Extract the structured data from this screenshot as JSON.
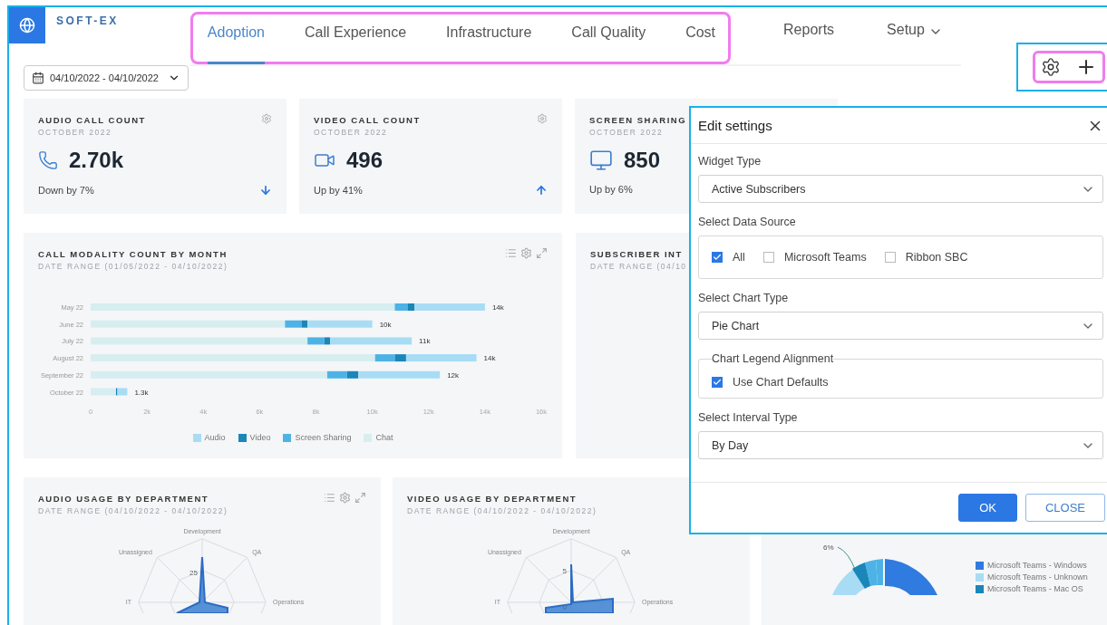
{
  "app": {
    "logo_text": "SOFT-EX"
  },
  "nav": {
    "tabs": [
      {
        "label": "Adoption",
        "selected": true,
        "kind": "tab"
      },
      {
        "label": "Call Experience",
        "selected": false,
        "kind": "tab"
      },
      {
        "label": "Infrastructure",
        "selected": false,
        "kind": "tab"
      },
      {
        "label": "Call Quality",
        "selected": false,
        "kind": "tab"
      },
      {
        "label": "Cost",
        "selected": false,
        "kind": "tab"
      },
      {
        "label": "Reports",
        "selected": false,
        "kind": "tab"
      },
      {
        "label": "Setup",
        "selected": false,
        "kind": "menu"
      }
    ]
  },
  "date_range": {
    "value": "04/10/2022 - 04/10/2022"
  },
  "kpi_cards": [
    {
      "kind": "audio",
      "title": "AUDIO CALL COUNT",
      "subtitle": "OCTOBER 2022",
      "value": "2.70k",
      "change": "Down by 7%",
      "rising": false,
      "settings": true
    },
    {
      "kind": "video",
      "title": "VIDEO CALL COUNT",
      "subtitle": "OCTOBER 2022",
      "value": "496",
      "change": "Up by 41%",
      "rising": true,
      "settings": true
    },
    {
      "kind": "screen",
      "title": "SCREEN SHARING",
      "subtitle": "OCTOBER 2022",
      "value": "850",
      "change": "Up by 6%",
      "settings": false
    }
  ],
  "modality_card": {
    "title": "CALL MODALITY COUNT BY MONTH",
    "subtitle": "DATE RANGE (01/05/2022 - 04/10/2022)",
    "chart_data": {
      "type": "bar",
      "orientation": "horizontal",
      "stacked": true,
      "categories": [
        "May 22",
        "June 22",
        "July 22",
        "August 22",
        "September 22",
        "October 22"
      ],
      "series": [
        {
          "name": "Audio",
          "color": "#a8dcf5",
          "values": [
            2.5,
            2.3,
            2.9,
            2.5,
            2.9,
            0.35
          ]
        },
        {
          "name": "Video",
          "color": "#1b86b8",
          "values": [
            0.25,
            0.2,
            0.2,
            0.4,
            0.4,
            0.05
          ]
        },
        {
          "name": "Screen Sharing",
          "color": "#4db3e6",
          "values": [
            0.45,
            0.6,
            0.6,
            0.7,
            0.7,
            0
          ]
        },
        {
          "name": "Chat",
          "color": "#d6eef0",
          "values": [
            10.8,
            6.9,
            7.7,
            10.1,
            8.4,
            0.9
          ]
        }
      ],
      "xlim": [
        0,
        16
      ],
      "xticks": [
        0,
        {
          "value": 2,
          "label": "2k"
        },
        {
          "value": 4,
          "label": "4k"
        },
        {
          "value": 6,
          "label": "6k"
        },
        {
          "value": 8,
          "label": "8k"
        },
        {
          "value": 10,
          "label": "10k"
        },
        {
          "value": 12,
          "label": "12k"
        },
        {
          "value": 14,
          "label": "14k"
        },
        {
          "value": 16,
          "label": "16k"
        }
      ],
      "value_labels": [
        "14k",
        "10k",
        "11k",
        "14k",
        "12k",
        "1.3k"
      ]
    }
  },
  "subscriber_card": {
    "title": "SUBSCRIBER INT",
    "subtitle": "DATE RANGE (04/10"
  },
  "department_cards": [
    {
      "title": "AUDIO USAGE BY DEPARTMENT",
      "subtitle": "DATE RANGE (04/10/2022 - 04/10/2022)",
      "toolbar": true,
      "axes": [
        "Development",
        "QA",
        "Operations",
        "IT",
        "Unassigned"
      ],
      "scale_labels": [
        "25"
      ]
    },
    {
      "title": "VIDEO USAGE BY DEPARTMENT",
      "subtitle": "DATE RANGE (04/10/2022 - 04/10/2022)",
      "toolbar": false,
      "axes": [
        "Development",
        "QA",
        "Operations",
        "IT",
        "Unassigned"
      ],
      "scale_labels": [
        "5",
        "0"
      ]
    }
  ],
  "platform_card": {
    "slice_label": "6%",
    "legend": [
      {
        "label": "Microsoft Teams - Windows",
        "color": "#2f7be0"
      },
      {
        "label": "Microsoft Teams - Unknown",
        "color": "#a8dcf5"
      },
      {
        "label": "Microsoft Teams - Mac OS",
        "color": "#1b86b8"
      }
    ]
  },
  "modal": {
    "title": "Edit settings",
    "widget_type": {
      "label": "Widget Type",
      "value": "Active Subscribers"
    },
    "data_source_label": "Select Data Source",
    "data_sources": [
      {
        "label": "All",
        "checked": true
      },
      {
        "label": "Microsoft Teams",
        "checked": false
      },
      {
        "label": "Ribbon SBC",
        "checked": false
      }
    ],
    "chart_type": {
      "label": "Select Chart Type",
      "value": "Pie Chart"
    },
    "legend_group": {
      "label": "Chart Legend Alignment",
      "option": {
        "label": "Use Chart Defaults",
        "checked": true
      }
    },
    "interval_type": {
      "label": "Select Interval Type",
      "value": "By Day"
    },
    "buttons": [
      {
        "label": "OK",
        "kind": "primary"
      },
      {
        "label": "CLOSE",
        "kind": "secondary"
      }
    ]
  }
}
